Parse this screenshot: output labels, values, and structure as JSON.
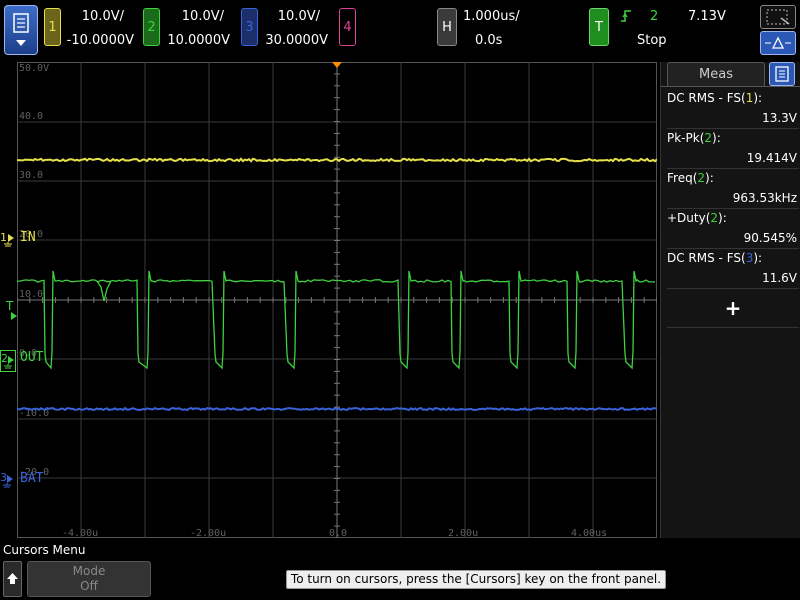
{
  "channels": [
    {
      "num": "1",
      "scale": "10.0V/",
      "offset": "-10.0000V",
      "color": "#e5e04a"
    },
    {
      "num": "2",
      "scale": "10.0V/",
      "offset": "10.0000V",
      "color": "#3fd13f"
    },
    {
      "num": "3",
      "scale": "10.0V/",
      "offset": "30.0000V",
      "color": "#3a62d9"
    },
    {
      "num": "4",
      "color": "#e0409a"
    }
  ],
  "horizontal": {
    "tag": "H",
    "scale": "1.000us/",
    "position": "0.0s"
  },
  "trigger": {
    "tag": "T",
    "source": "2",
    "level": "7.13V",
    "status": "Stop"
  },
  "y_labels": [
    "50.0V",
    "40.0",
    "30.0",
    "20.0",
    "10.0",
    "0.0",
    "-10.0",
    "-20.0"
  ],
  "x_labels": [
    "-4.00u",
    "-2.00u",
    "0.0",
    "2.00u",
    "4.00us"
  ],
  "markers": {
    "in": "IN",
    "out": "OUT",
    "bat": "BAT",
    "trig": "T",
    "gnd1": "1",
    "gnd2": "2",
    "gnd3": "3"
  },
  "meas": {
    "title": "Meas",
    "items": [
      {
        "label": "DC RMS - FS(",
        "ch": "1",
        "tail": "):",
        "value": "13.3V",
        "color": "#e5e04a"
      },
      {
        "label": "Pk-Pk(",
        "ch": "2",
        "tail": "):",
        "value": "19.414V",
        "color": "#3fd13f"
      },
      {
        "label": "Freq(",
        "ch": "2",
        "tail": "):",
        "value": "963.53kHz",
        "color": "#3fd13f"
      },
      {
        "label": "+Duty(",
        "ch": "2",
        "tail": "):",
        "value": "90.545%",
        "color": "#3fd13f"
      },
      {
        "label": "DC RMS - FS(",
        "ch": "3",
        "tail": "):",
        "value": "11.6V",
        "color": "#3a62d9"
      }
    ],
    "add": "+"
  },
  "bottom": {
    "menu_title": "Cursors Menu",
    "mode_label": "Mode",
    "mode_value": "Off",
    "hint": "To turn on cursors, press the [Cursors] key on the front panel."
  }
}
